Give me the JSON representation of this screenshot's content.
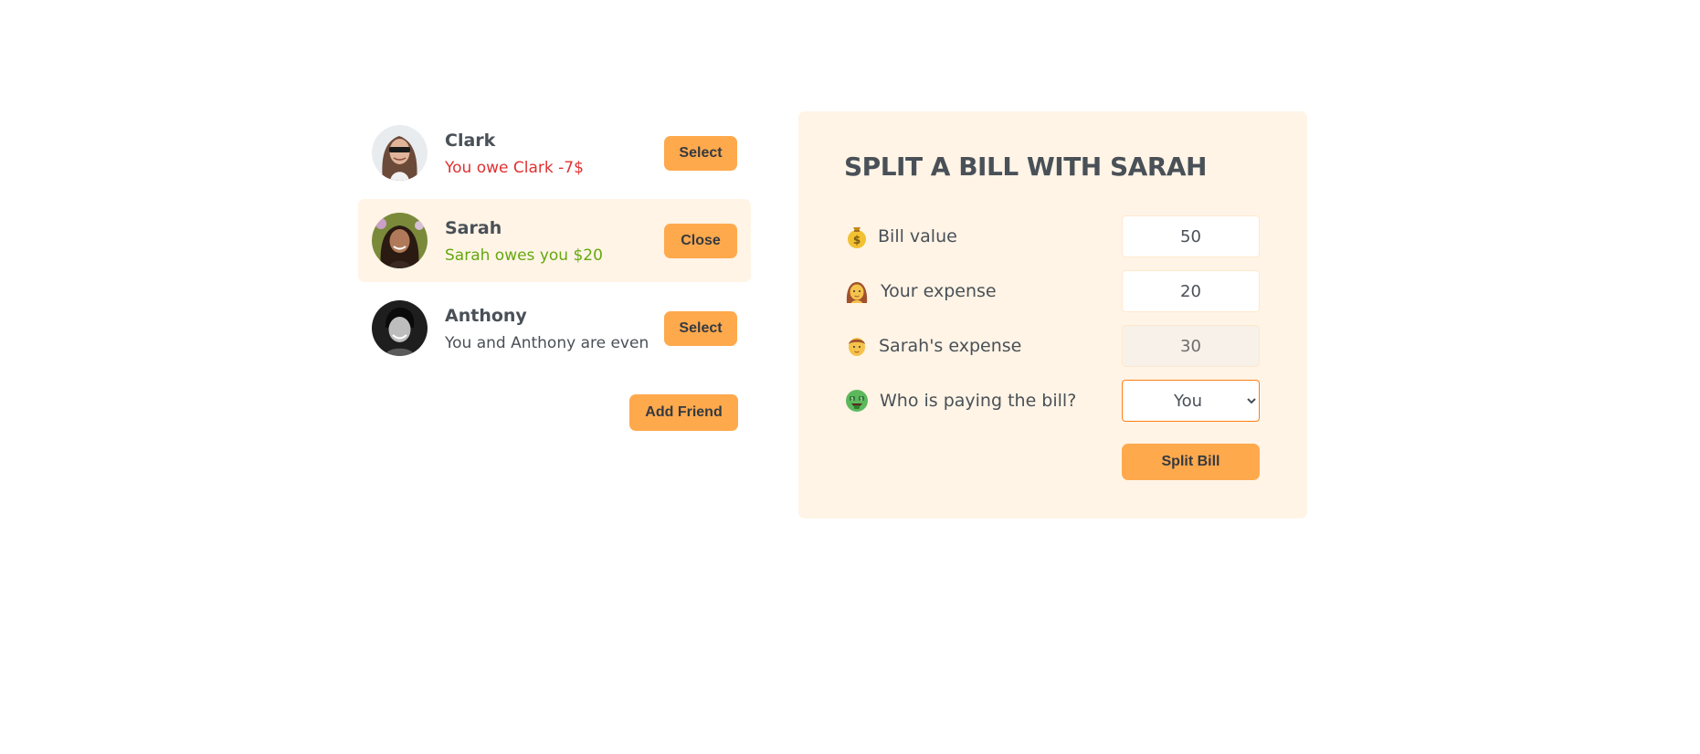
{
  "friends": [
    {
      "name": "Clark",
      "status": "You owe Clark -7$",
      "status_type": "owe",
      "button_label": "Select",
      "selected": false
    },
    {
      "name": "Sarah",
      "status": "Sarah owes you $20",
      "status_type": "owed",
      "button_label": "Close",
      "selected": true
    },
    {
      "name": "Anthony",
      "status": "You and Anthony are even",
      "status_type": "even",
      "button_label": "Select",
      "selected": false
    }
  ],
  "add_friend_label": "Add Friend",
  "split_form": {
    "title": "SPLIT A BILL WITH SARAH",
    "bill_value": {
      "icon": "money-bag-icon",
      "label": "Bill value",
      "value": "50"
    },
    "your_expense": {
      "icon": "woman-icon",
      "label": "Your expense",
      "value": "20"
    },
    "friend_expense": {
      "icon": "person-icon",
      "label": "Sarah's expense",
      "value": "30"
    },
    "payer": {
      "icon": "money-mouth-face-icon",
      "label": "Who is paying the bill?",
      "selected": "You"
    },
    "submit_label": "Split Bill"
  },
  "colors": {
    "accent": "#ffa94d",
    "panel_bg": "#fff4e6",
    "owe": "#e03131",
    "owed": "#66a80f",
    "text": "#495057"
  }
}
